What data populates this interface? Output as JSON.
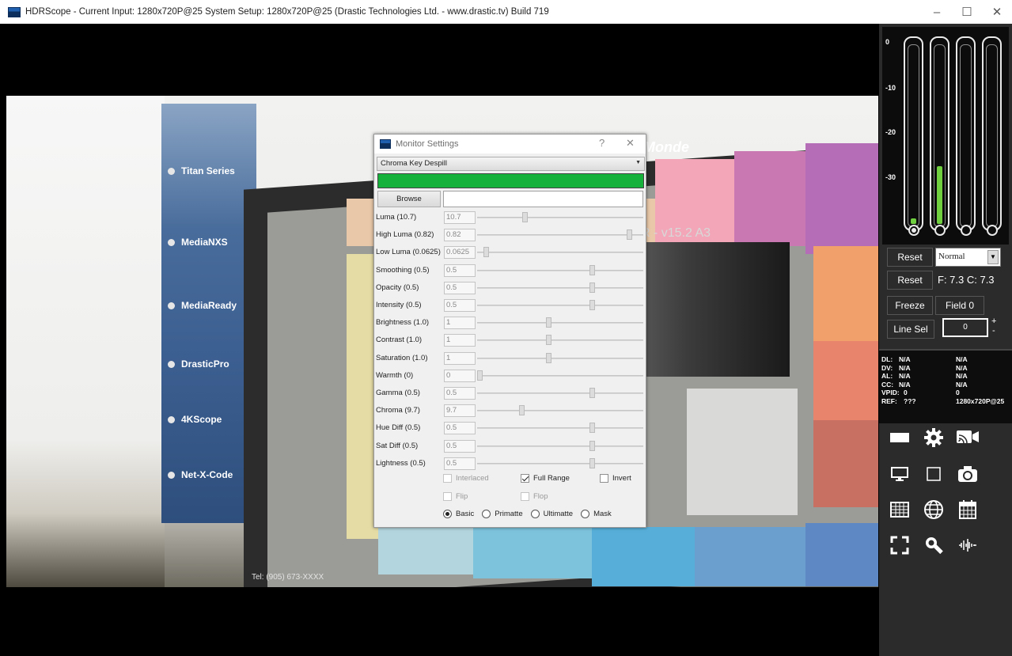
{
  "window": {
    "title": "HDRScope -  Current Input: 1280x720P@25   System Setup: 1280x720P@25    (Drastic Technologies Ltd. - www.drastic.tv) Build 719",
    "minimize": "–",
    "maximize": "☐",
    "close": "✕"
  },
  "video": {
    "banner_items": [
      "Titan Series",
      "MediaNXS",
      "MediaReady",
      "DrasticPro",
      "4KScope",
      "Net-X-Code"
    ],
    "monitor_logo": "Monde",
    "chart_ref": "R - v15.2 A3",
    "bottom_text": "Tel: (905) 673-XXXX"
  },
  "dialog": {
    "title": "Monitor Settings",
    "help": "?",
    "close": "✕",
    "mode": "Chroma Key Despill",
    "key_color": "#15b13a",
    "browse_label": "Browse",
    "path_value": "",
    "sliders": [
      {
        "label": "Luma (10.7)",
        "value": "10.7",
        "pos": 0.28
      },
      {
        "label": "High Luma (0.82)",
        "value": "0.82",
        "pos": 0.93
      },
      {
        "label": "Low Luma (0.0625)",
        "value": "0.0625",
        "pos": 0.04
      },
      {
        "label": "Smoothing (0.5)",
        "value": "0.5",
        "pos": 0.7
      },
      {
        "label": "Opacity (0.5)",
        "value": "0.5",
        "pos": 0.7
      },
      {
        "label": "Intensity (0.5)",
        "value": "0.5",
        "pos": 0.7
      },
      {
        "label": "Brightness (1.0)",
        "value": "1",
        "pos": 0.43
      },
      {
        "label": "Contrast (1.0)",
        "value": "1",
        "pos": 0.43
      },
      {
        "label": "Saturation (1.0)",
        "value": "1",
        "pos": 0.43
      },
      {
        "label": "Warmth (0)",
        "value": "0",
        "pos": 0.0
      },
      {
        "label": "Gamma (0.5)",
        "value": "0.5",
        "pos": 0.7
      },
      {
        "label": "Chroma (9.7)",
        "value": "9.7",
        "pos": 0.26
      },
      {
        "label": "Hue Diff (0.5)",
        "value": "0.5",
        "pos": 0.7
      },
      {
        "label": "Sat Diff (0.5)",
        "value": "0.5",
        "pos": 0.7
      },
      {
        "label": "Lightness (0.5)",
        "value": "0.5",
        "pos": 0.7
      }
    ],
    "checks_row1": [
      {
        "label": "Interlaced",
        "checked": false,
        "disabled": true
      },
      {
        "label": "Full Range",
        "checked": true,
        "disabled": false
      },
      {
        "label": "Invert",
        "checked": false,
        "disabled": false
      }
    ],
    "checks_row2": [
      {
        "label": "Flip",
        "checked": false,
        "disabled": true
      },
      {
        "label": "Flop",
        "checked": false,
        "disabled": true
      }
    ],
    "radios": [
      {
        "label": "Basic",
        "selected": true
      },
      {
        "label": "Primatte",
        "selected": false
      },
      {
        "label": "Ultimatte",
        "selected": false
      },
      {
        "label": "Mask",
        "selected": false
      }
    ]
  },
  "panel": {
    "meter_labels": [
      "0",
      "-10",
      "-20",
      "-30"
    ],
    "meter_levels": [
      0.03,
      0.32,
      0.0,
      0.0
    ],
    "meter_color": "#6fcf3f",
    "reset1": "Reset",
    "mode_select": "Normal",
    "reset2": "Reset",
    "fc_readout": "F: 7.3  C: 7.3",
    "freeze": "Freeze",
    "field": "Field 0",
    "line_sel": "Line Sel",
    "line_value": "0",
    "plus": "+",
    "minus": "-",
    "info": [
      {
        "k": "DL:",
        "v1": "N/A",
        "v2": "N/A"
      },
      {
        "k": "DV:",
        "v1": "N/A",
        "v2": "N/A"
      },
      {
        "k": "AL:",
        "v1": "N/A",
        "v2": "N/A"
      },
      {
        "k": "CC:",
        "v1": "N/A",
        "v2": "N/A"
      },
      {
        "k": "VPID:",
        "v1": "0",
        "v2": "0"
      },
      {
        "k": "REF:",
        "v1": "???",
        "v2": "1280x720P@25"
      }
    ],
    "icons": [
      "display-rect-icon",
      "gear-icon",
      "cast-icon",
      "monitor-icon",
      "square-icon",
      "camera-icon",
      "grid-icon",
      "globe-icon",
      "calendar-icon",
      "fullscreen-icon",
      "search-icon",
      "waveform-icon"
    ]
  }
}
